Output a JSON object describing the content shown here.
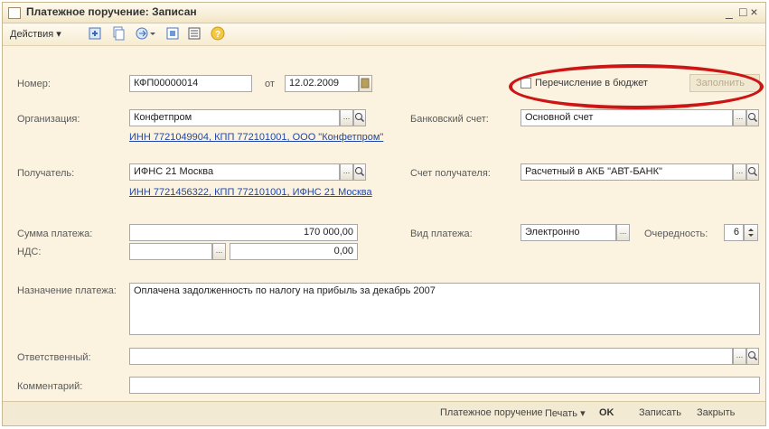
{
  "window": {
    "title": "Платежное поручение: Записан",
    "minimize": "_",
    "close": "□ ×"
  },
  "toolbar": {
    "actions_label": "Действия ▾"
  },
  "fields": {
    "number": {
      "label": "Номер:",
      "value": "КФП00000014",
      "date_label": "от",
      "date_value": "12.02.2009"
    },
    "budget": {
      "label": "Перечисление в бюджет",
      "checked": false,
      "fill_button": "Заполнить"
    },
    "organization": {
      "label": "Организация:",
      "value": "Конфетпром",
      "details": "ИНН 7721049904, КПП 772101001, ООО \"Конфетпром\""
    },
    "bank_account": {
      "label": "Банковский счет:",
      "value": "Основной счет"
    },
    "recipient": {
      "label": "Получатель:",
      "value": "ИФНС 21 Москва",
      "details": "ИНН 7721456322, КПП 772101001, ИФНС 21 Москва"
    },
    "recipient_account": {
      "label": "Счет получателя:",
      "value": "Расчетный в АКБ \"АВТ-БАНК\""
    },
    "amount": {
      "label": "Сумма платежа:",
      "value": "170 000,00"
    },
    "payment_type": {
      "label": "Вид платежа:",
      "value": "Электронно"
    },
    "priority": {
      "label": "Очередность:",
      "value": "6"
    },
    "vat": {
      "label": "НДС:",
      "rate": "",
      "value": "0,00"
    },
    "purpose": {
      "label": "Назначение платежа:",
      "value": "Оплачена задолженность по налогу на прибыль за декабрь 2007"
    },
    "responsible": {
      "label": "Ответственный:",
      "value": ""
    },
    "comment": {
      "label": "Комментарий:",
      "value": ""
    }
  },
  "bottom_bar": {
    "print_form": "Платежное поручение",
    "print": "Печать ▾",
    "ok": "OK",
    "save": "Записать",
    "close": "Закрыть"
  },
  "colors": {
    "accent_oval": "#cc1515",
    "link": "#2147a8",
    "background": "#fbf3e0"
  }
}
